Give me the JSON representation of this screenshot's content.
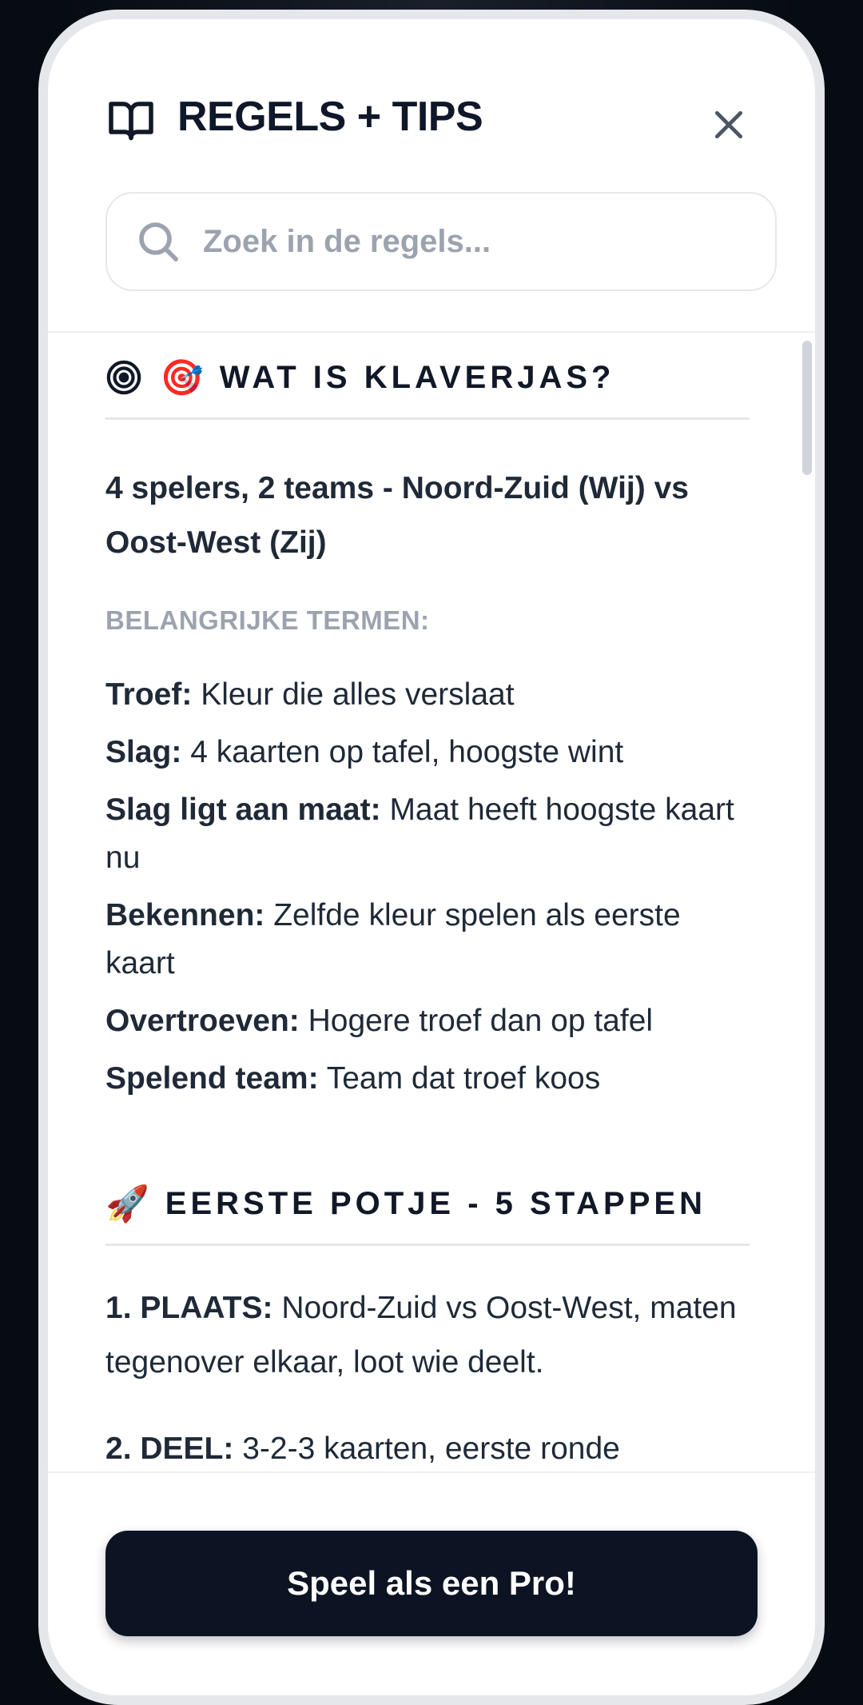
{
  "modal": {
    "title": "REGELS + TIPS",
    "search_placeholder": "Zoek in de regels..."
  },
  "section_what": {
    "title_emoji": "🎯",
    "title": "WAT IS KLAVERJAS?",
    "intro": "4 spelers, 2 teams - Noord-Zuid (Wij) vs Oost-West (Zij)",
    "subhead": "BELANGRIJKE TERMEN:",
    "terms": [
      {
        "term": "Troef:",
        "definition": "Kleur die alles verslaat"
      },
      {
        "term": "Slag:",
        "definition": "4 kaarten op tafel, hoogste wint"
      },
      {
        "term": "Slag ligt aan maat:",
        "definition": "Maat heeft hoogste kaart nu"
      },
      {
        "term": "Bekennen:",
        "definition": "Zelfde kleur spelen als eerste kaart"
      },
      {
        "term": "Overtroeven:",
        "definition": "Hogere troef dan op tafel"
      },
      {
        "term": "Spelend team:",
        "definition": "Team dat troef koos"
      }
    ]
  },
  "section_first": {
    "title_emoji": "🚀",
    "title": "EERSTE POTJE - 5 STAPPEN",
    "steps": [
      {
        "label": "1. PLAATS:",
        "text": "Noord-Zuid vs Oost-West, maten tegenover elkaar, loot wie deelt."
      },
      {
        "label": "2. DEEL:",
        "text": "3-2-3 kaarten, eerste ronde"
      }
    ]
  },
  "footer": {
    "cta_label": "Speel als een Pro!"
  },
  "icons": {
    "book": "book-open-icon",
    "close": "close-icon",
    "search": "search-icon",
    "target": "target-icon"
  }
}
